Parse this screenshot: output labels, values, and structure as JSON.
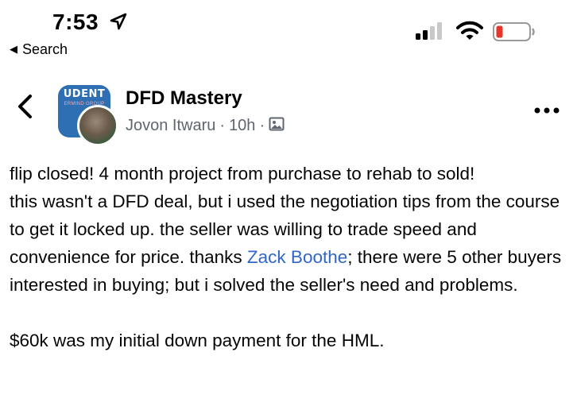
{
  "status_bar": {
    "time": "7:53",
    "back_label": "Search",
    "icons": [
      "location-arrow-icon",
      "cell-signal-icon",
      "wifi-icon",
      "battery-low-icon"
    ]
  },
  "post": {
    "group_name": "DFD Mastery",
    "author": "Jovon Itwaru",
    "time_ago": "10h",
    "separator": "·",
    "avatar": {
      "line1": "UDENT",
      "line2": "ERMIND GROUP"
    },
    "body": {
      "line1": "flip closed! 4 month project from purchase to rehab to sold!",
      "line2_pre": "this wasn't a DFD deal, but i used the negotiation tips from the course to get it locked up. the seller was willing to trade speed and convenience for price. thanks ",
      "mention": "Zack Boothe",
      "line2_post": "; there were 5 other buyers interested in buying; but i solved the seller's need and problems.",
      "line3": "$60k was my initial down payment for the HML."
    }
  },
  "colors": {
    "mention": "#2f66c8",
    "meta_text": "#5f6670",
    "battery_low": "#e8352b",
    "avatar_bg": "#2e6fb3"
  }
}
